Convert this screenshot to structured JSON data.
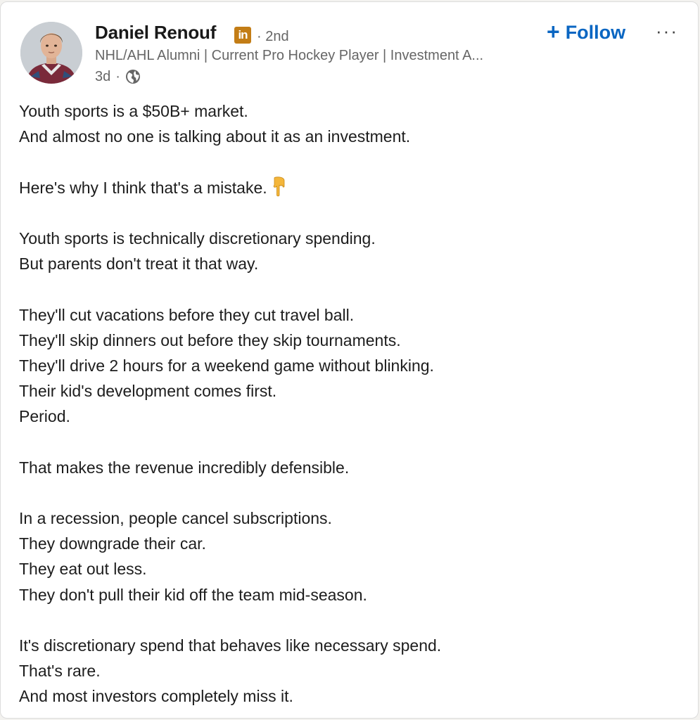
{
  "author": {
    "name": "Daniel Renouf",
    "badge_text": "in",
    "degree": "· 2nd",
    "headline": "NHL/AHL Alumni | Current Pro Hockey Player | Investment A...",
    "time_posted": "3d",
    "meta_separator": "·",
    "visibility_icon": "globe-icon"
  },
  "actions": {
    "follow_icon": "+",
    "follow_label": "Follow",
    "more_label": "···"
  },
  "post": {
    "lines": [
      "Youth sports is a $50B+ market.",
      "And almost no one is talking about it as an investment.",
      "",
      "Here's why I think that's a mistake.",
      "",
      "Youth sports is technically discretionary spending.",
      "But parents don't treat it that way.",
      "",
      "They'll cut vacations before they cut travel ball.",
      "They'll skip dinners out before they skip tournaments.",
      "They'll drive 2 hours for a weekend game without blinking.",
      "Their kid's development comes first.",
      "Period.",
      "",
      "That makes the revenue incredibly defensible.",
      "",
      "In a recession, people cancel subscriptions.",
      "They downgrade their car.",
      "They eat out less.",
      "They don't pull their kid off the team mid-season.",
      "",
      "It's discretionary spend that behaves like necessary spend.",
      "That's rare.",
      "And most investors completely miss it."
    ],
    "emoji_icon": "pointing-down-hand-icon"
  },
  "colors": {
    "link_blue": "#0a66c2",
    "badge_gold": "#c37d16",
    "text_primary": "#1d1d1d",
    "text_secondary": "#666666"
  }
}
